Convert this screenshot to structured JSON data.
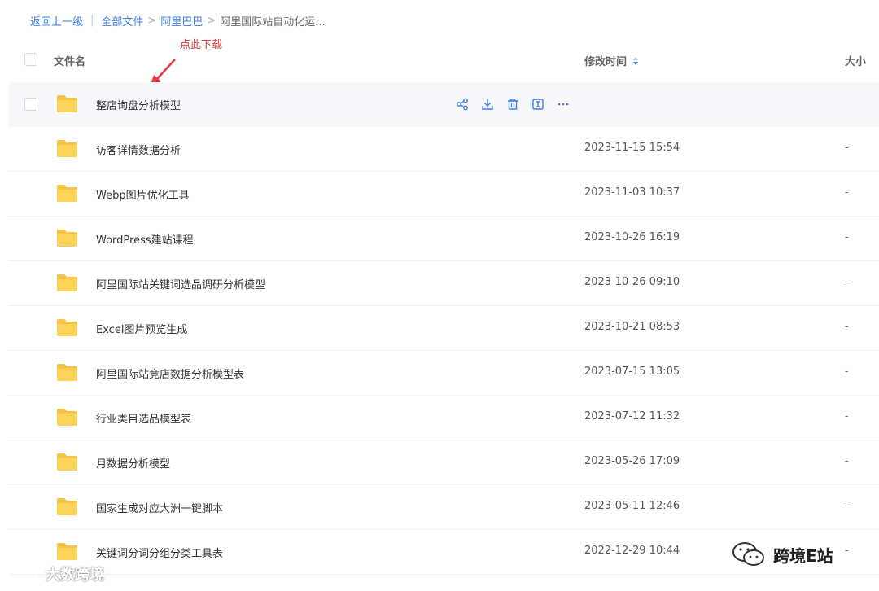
{
  "breadcrumb": {
    "back": "返回上一级",
    "items": [
      "全部文件",
      "阿里巴巴"
    ],
    "current": "阿里国际站自动化运..."
  },
  "annotation": {
    "text": "点此下载",
    "color": "#e8383d"
  },
  "table": {
    "headers": {
      "name": "文件名",
      "modified": "修改时间",
      "size": "大小"
    },
    "rows": [
      {
        "name": "整店询盘分析模型",
        "modified": "",
        "size": ""
      },
      {
        "name": "访客详情数据分析",
        "modified": "2023-11-15 15:54",
        "size": "-"
      },
      {
        "name": "Webp图片优化工具",
        "modified": "2023-11-03 10:37",
        "size": "-"
      },
      {
        "name": "WordPress建站课程",
        "modified": "2023-10-26 16:19",
        "size": "-"
      },
      {
        "name": "阿里国际站关键词选品调研分析模型",
        "modified": "2023-10-26 09:10",
        "size": "-"
      },
      {
        "name": "Excel图片预览生成",
        "modified": "2023-10-21 08:53",
        "size": "-"
      },
      {
        "name": "阿里国际站竞店数据分析模型表",
        "modified": "2023-07-15 13:05",
        "size": "-"
      },
      {
        "name": "行业类目选品模型表",
        "modified": "2023-07-12 11:32",
        "size": "-"
      },
      {
        "name": "月数据分析模型",
        "modified": "2023-05-26 17:09",
        "size": "-"
      },
      {
        "name": "国家生成对应大洲一键脚本",
        "modified": "2023-05-11 12:46",
        "size": "-"
      },
      {
        "name": "关键词分词分组分类工具表",
        "modified": "2022-12-29 10:44",
        "size": "-"
      }
    ]
  },
  "row_actions": [
    "share-icon",
    "download-icon",
    "delete-icon",
    "rename-icon",
    "more-icon"
  ],
  "watermarks": {
    "left": "大数跨境",
    "right": "跨境E站"
  },
  "colors": {
    "accent": "#3f7ee8",
    "folder": "#f9cd4f",
    "hover_row": "#f7f8fb"
  }
}
